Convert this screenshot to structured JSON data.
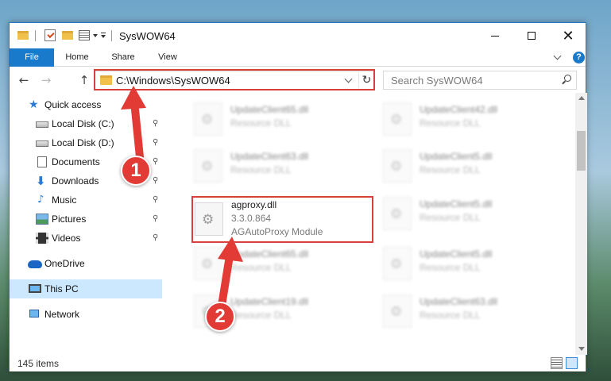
{
  "window": {
    "title": "SysWOW64",
    "minimize_glyph": "",
    "close_glyph": "✕"
  },
  "ribbon": {
    "tabs": [
      "File",
      "Home",
      "Share",
      "View"
    ],
    "help_label": "?"
  },
  "navigation": {
    "back_glyph": "←",
    "forward_glyph": "→",
    "up_glyph": "↑",
    "address": "C:\\Windows\\SysWOW64",
    "refresh_glyph": "↻",
    "search_placeholder": "Search SysWOW64"
  },
  "sidebar": {
    "items": [
      {
        "label": "Quick access",
        "icon": "star-icon",
        "pinned": false
      },
      {
        "label": "Local Disk (C:)",
        "icon": "drive-icon",
        "pinned": true
      },
      {
        "label": "Local Disk (D:)",
        "icon": "drive-icon",
        "pinned": true
      },
      {
        "label": "Documents",
        "icon": "documents-icon",
        "pinned": true
      },
      {
        "label": "Downloads",
        "icon": "download-icon",
        "pinned": true
      },
      {
        "label": "Music",
        "icon": "music-icon",
        "pinned": true
      },
      {
        "label": "Pictures",
        "icon": "pictures-icon",
        "pinned": true
      },
      {
        "label": "Videos",
        "icon": "videos-icon",
        "pinned": true
      },
      {
        "label": "OneDrive",
        "icon": "onedrive-icon",
        "pinned": false
      },
      {
        "label": "This PC",
        "icon": "this-pc-icon",
        "pinned": false,
        "selected": true
      },
      {
        "label": "Network",
        "icon": "network-icon",
        "pinned": false
      }
    ],
    "pin_glyph": "📌"
  },
  "files": {
    "highlighted": {
      "name": "agproxy.dll",
      "version": "3.3.0.864",
      "description": "AGAutoProxy Module"
    },
    "left_column": [
      {
        "name": "UpdateClient65.dll",
        "type": "Resource DLL"
      },
      {
        "name": "UpdateClient63.dll",
        "type": "Resource DLL"
      },
      {
        "name": "UpdateClient65.dll",
        "type": "Resource DLL"
      },
      {
        "name": "UpdateClient19.dll",
        "type": "Resource DLL"
      }
    ],
    "right_column": [
      {
        "name": "UpdateClient42.dll",
        "type": "Resource DLL"
      },
      {
        "name": "UpdateClient5.dll",
        "type": "Resource DLL"
      },
      {
        "name": "UpdateClient5.dll",
        "type": "Resource DLL"
      },
      {
        "name": "UpdateClient5.dll",
        "type": "Resource DLL"
      },
      {
        "name": "UpdateClient63.dll",
        "type": "Resource DLL"
      }
    ]
  },
  "status": {
    "item_count": "145 items"
  },
  "callouts": {
    "step1": "1",
    "step2": "2",
    "color": "#e23a35"
  }
}
